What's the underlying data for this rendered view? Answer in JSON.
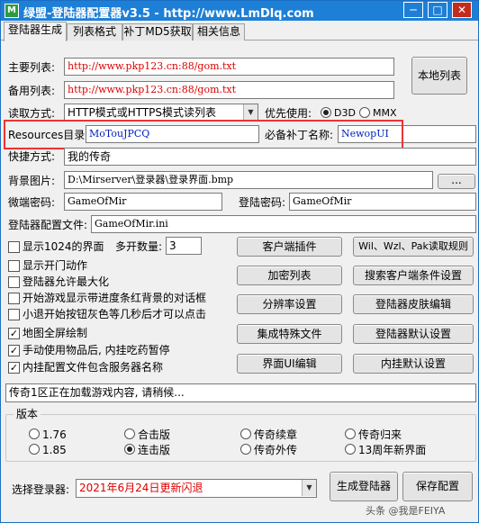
{
  "window": {
    "title": "绿盟-登陆器配置器v3.5 - http://www.LmDlq.com",
    "icon_glyph": "M",
    "minimize": "─",
    "maximize": "□",
    "close": "✕"
  },
  "tabs": [
    {
      "label": "登陆器生成",
      "active": true
    },
    {
      "label": "列表格式"
    },
    {
      "label": "补丁MD5获取"
    },
    {
      "label": "相关信息"
    }
  ],
  "form": {
    "main_list_label": "主要列表:",
    "main_list_value": "http://www.pkp123.cn:88/gom.txt",
    "backup_list_label": "备用列表:",
    "backup_list_value": "http://www.pkp123.cn:88/gom.txt",
    "local_list_button": "本地列表",
    "read_mode_label": "读取方式:",
    "read_mode_value": "HTTP模式或HTTPS模式读列表",
    "priority_label": "优先使用:",
    "priority_d3d": "D3D",
    "priority_mmx": "MMX",
    "resources_label": "Resources目录:",
    "resources_value": "MoTouJPCQ",
    "patch_label": "必备补丁名称:",
    "patch_value": "NewopUI",
    "shortcut_label": "快捷方式:",
    "shortcut_value": "我的传奇",
    "bg_label": "背景图片:",
    "bg_value": "D:\\Mirserver\\登录器\\登录界面.bmp",
    "browse_button": "...",
    "micro_pwd_label": "微端密码:",
    "micro_pwd_value": "GameOfMir",
    "login_pwd_label": "登陆密码:",
    "login_pwd_value": "GameOfMir",
    "config_file_label": "登陆器配置文件:",
    "config_file_value": "GameOfMir.ini"
  },
  "options": {
    "show_1024": "显示1024的界面",
    "multi_open_label": "多开数量:",
    "multi_open_value": "3",
    "show_open_anim": "显示开门动作",
    "allow_maximize": "登陆器允许最大化",
    "progress_dialog": "开始游戏显示带进度条红背景的对话框",
    "exit_gray": "小退开始按钮灰色等几秒后才可以点击",
    "fullscreen_map": "地图全屏绘制",
    "manual_items": "手动使用物品后, 内挂吃药暂停",
    "plugin_config": "内挂配置文件包含服务器名称"
  },
  "buttons": {
    "client_plugin": "客户端插件",
    "read_rules": "Wil、Wzl、Pak读取规则",
    "encrypt_list": "加密列表",
    "search_client": "搜索客户端条件设置",
    "resolution": "分辨率设置",
    "skin_edit": "登陆器皮肤编辑",
    "special_files": "集成特殊文件",
    "default_settings": "登陆器默认设置",
    "ui_edit": "界面UI编辑",
    "plugin_default": "内挂默认设置",
    "generate": "生成登陆器",
    "save_config": "保存配置"
  },
  "status_text": "传奇1区正在加载游戏内容, 请稍候...",
  "version": {
    "legend": "版本",
    "r1": "1.76",
    "r2": "合击版",
    "r3": "传奇续章",
    "r4": "传奇归来",
    "r5": "1.85",
    "r6": "连击版",
    "r7": "传奇外传",
    "r8": "13周年新界面"
  },
  "select_login": {
    "label": "选择登录器:",
    "value": "2021年6月24日更新闪退"
  },
  "watermark": "头条 @我是FEIYA",
  "colors": {
    "titlebar": "#1e7fd6",
    "url_text": "#dd0000",
    "input_text": "#0020c0",
    "highlight": "#ee3333"
  }
}
